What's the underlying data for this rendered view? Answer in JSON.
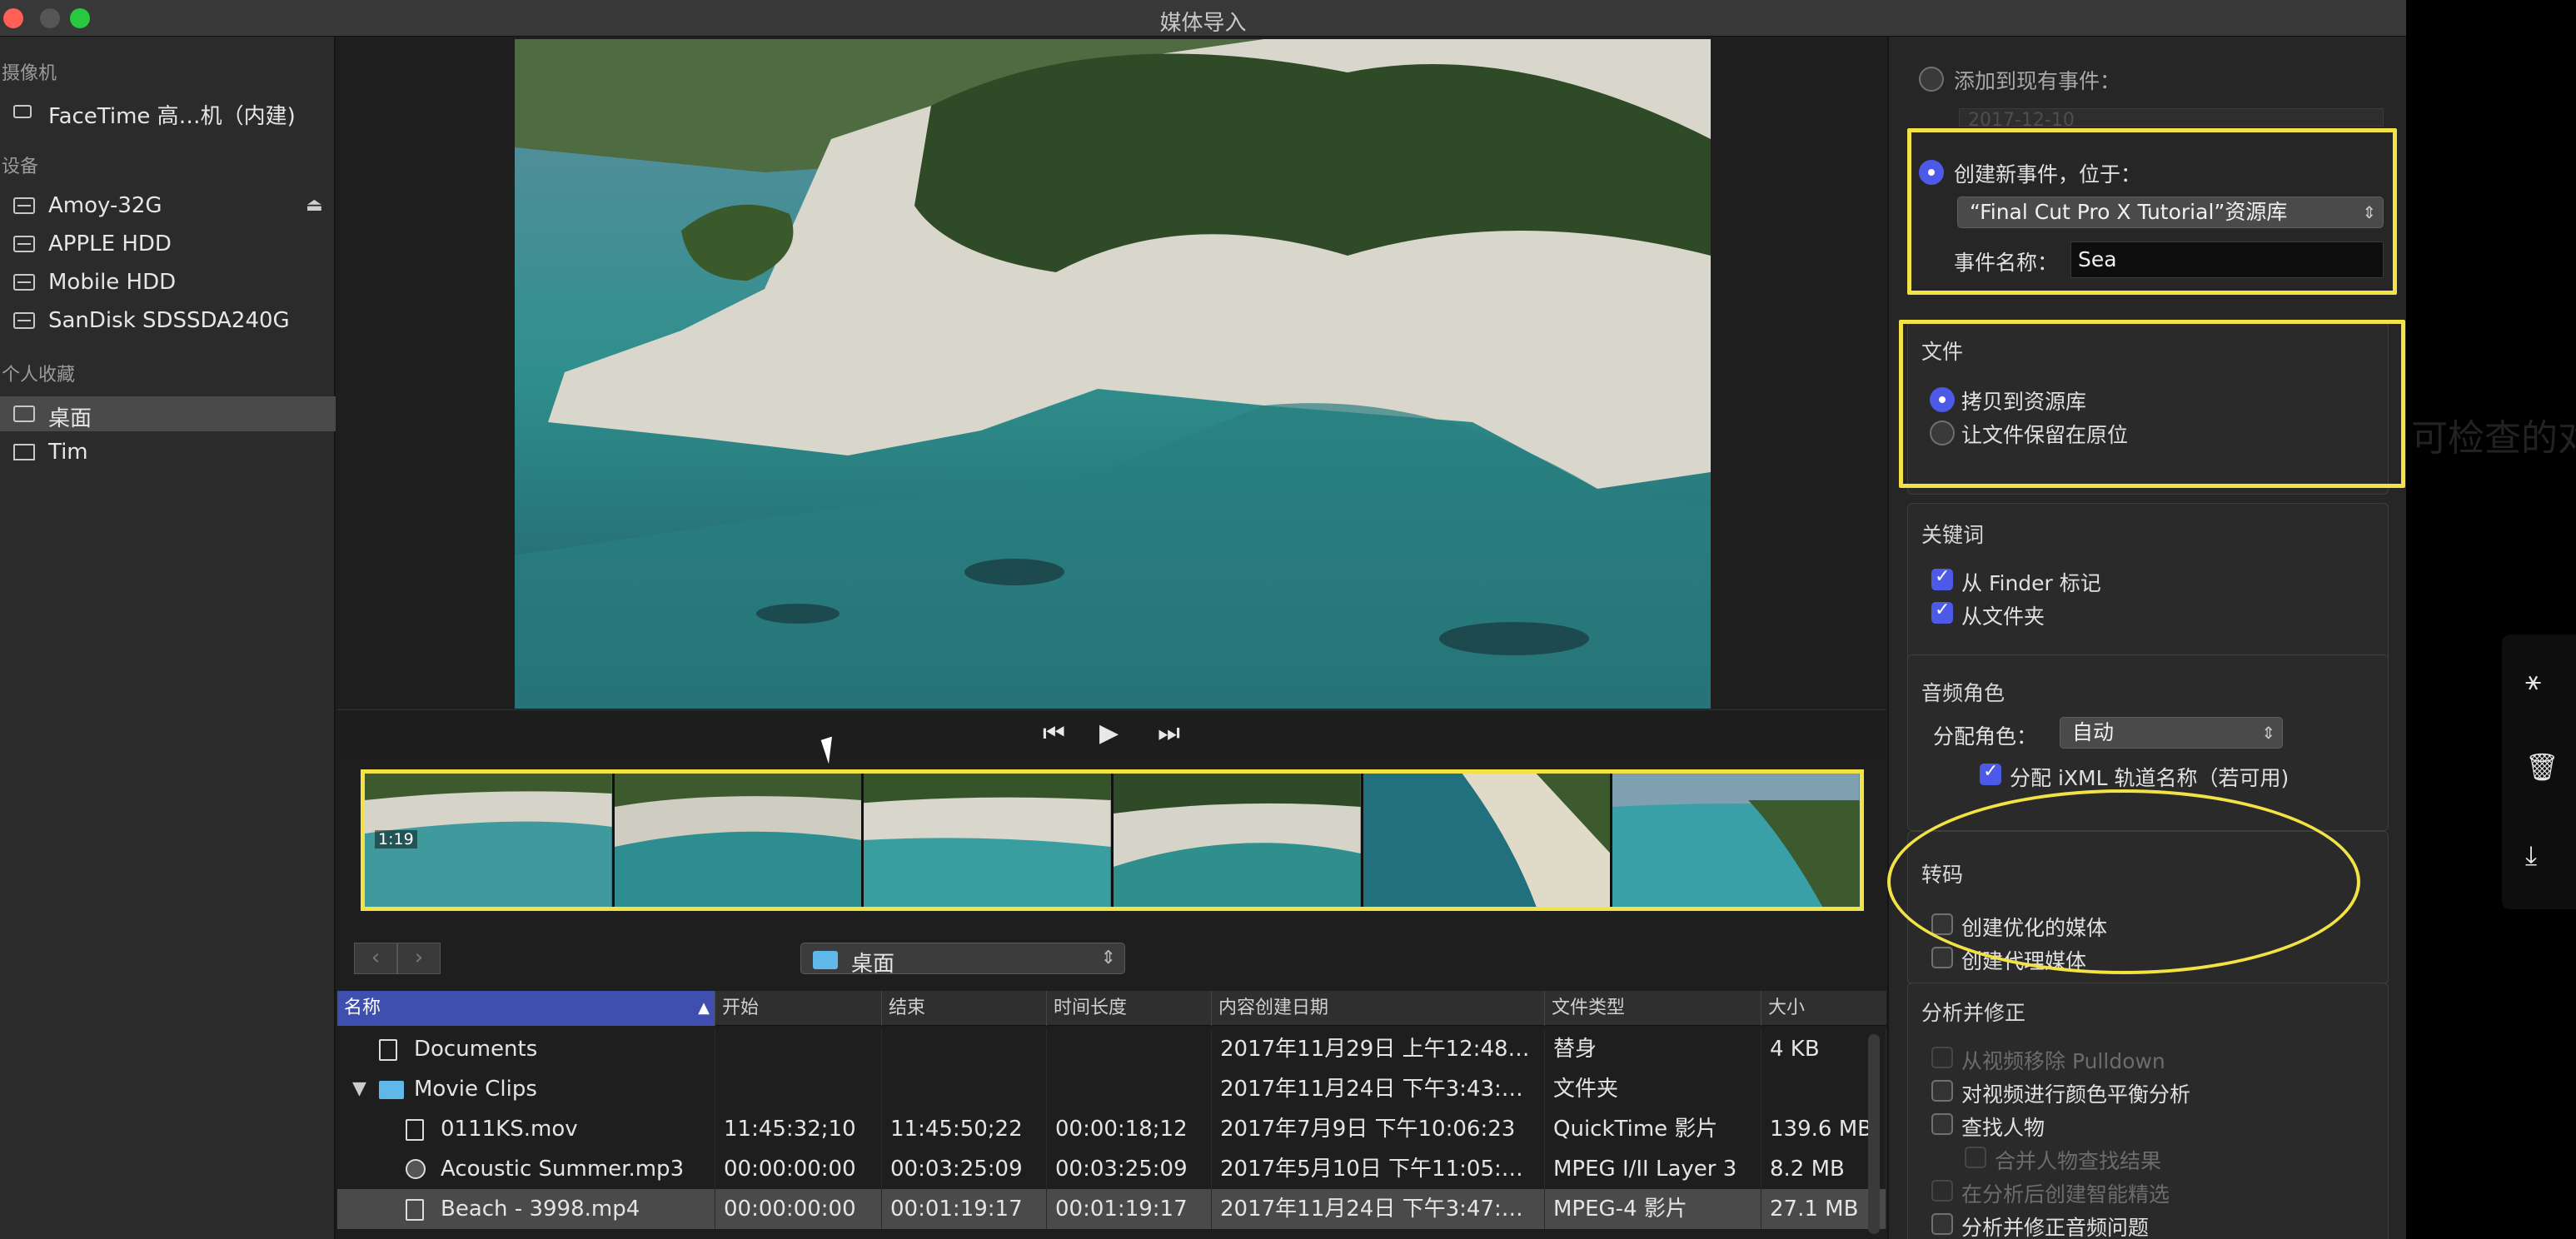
{
  "window": {
    "title": "媒体导入"
  },
  "sidebar": {
    "sections": [
      {
        "header": "摄像机",
        "items": [
          {
            "label": "FaceTime 高…机（内建)",
            "icon": "camera-icon"
          }
        ]
      },
      {
        "header": "设备",
        "items": [
          {
            "label": "Amoy-32G",
            "icon": "disk-icon",
            "eject": "⏏"
          },
          {
            "label": "APPLE HDD",
            "icon": "disk-icon"
          },
          {
            "label": "Mobile HDD",
            "icon": "disk-icon"
          },
          {
            "label": "SanDisk SDSSDA240G",
            "icon": "disk-icon"
          }
        ]
      },
      {
        "header": "个人收藏",
        "items": [
          {
            "label": "桌面",
            "icon": "desktop-icon",
            "selected": true
          },
          {
            "label": "Tim",
            "icon": "home-icon"
          }
        ]
      }
    ]
  },
  "transport": {
    "prev": "⏮",
    "play": "▶",
    "next": "⏭"
  },
  "filmstrip": {
    "duration": "1:19"
  },
  "browser": {
    "back": "‹",
    "forward": "›",
    "location": "桌面",
    "columns": [
      "名称",
      "开始",
      "结束",
      "时间长度",
      "内容创建日期",
      "文件类型",
      "大小"
    ],
    "rows": [
      {
        "name": "Documents",
        "start": "",
        "end": "",
        "duration": "",
        "created": "2017年11月29日 上午12:48…",
        "type": "替身",
        "size": "4 KB",
        "indent": 1,
        "icon": "alias",
        "expander": ""
      },
      {
        "name": "Movie Clips",
        "start": "",
        "end": "",
        "duration": "",
        "created": "2017年11月24日 下午3:43:…",
        "type": "文件夹",
        "size": "",
        "indent": 1,
        "icon": "folder",
        "expander": "▼"
      },
      {
        "name": "0111KS.mov",
        "start": "11:45:32;10",
        "end": "11:45:50;22",
        "duration": "00:00:18;12",
        "created": "2017年7月9日 下午10:06:23",
        "type": "QuickTime 影片",
        "size": "139.6 MB",
        "indent": 2,
        "icon": "doc",
        "expander": ""
      },
      {
        "name": "Acoustic Summer.mp3",
        "start": "00:00:00:00",
        "end": "00:03:25:09",
        "duration": "00:03:25:09",
        "created": "2017年5月10日 下午11:05:…",
        "type": "MPEG I/II Layer 3",
        "size": "8.2 MB",
        "indent": 2,
        "icon": "audio",
        "expander": ""
      },
      {
        "name": "Beach - 3998.mp4",
        "start": "00:00:00:00",
        "end": "00:01:19:17",
        "duration": "00:01:19:17",
        "created": "2017年11月24日 下午3:47:…",
        "type": "MPEG-4 影片",
        "size": "27.1 MB",
        "indent": 2,
        "icon": "doc",
        "expander": "",
        "selected": true
      }
    ]
  },
  "import_options": {
    "add_existing_label": "添加到现有事件：",
    "existing_date": "2017-12-10",
    "create_new_label": "创建新事件，位于：",
    "library": "“Final Cut Pro X Tutorial”资源库",
    "event_name_label": "事件名称：",
    "event_name": "Sea",
    "files": {
      "header": "文件",
      "copy": "拷贝到资源库",
      "leave": "让文件保留在原位"
    },
    "keywords": {
      "header": "关键词",
      "finder": "从 Finder 标记",
      "folders": "从文件夹"
    },
    "audio_roles": {
      "header": "音频角色",
      "assign_label": "分配角色：",
      "assign_value": "自动",
      "ixml": "分配 iXML 轨道名称（若可用)"
    },
    "transcode": {
      "header": "转码",
      "optimized": "创建优化的媒体",
      "proxy": "创建代理媒体"
    },
    "analyze": {
      "header": "分析并修正",
      "pulldown": "从视频移除 Pulldown",
      "color": "对视频进行颜色平衡分析",
      "people": "查找人物",
      "consolidate": "合并人物查找结果",
      "smart": "在分析后创建智能精选",
      "audio": "分析并修正音频问题"
    }
  },
  "background": {
    "ghost_text": "可检查的对"
  },
  "side_strip": {
    "share": "share-icon",
    "delete": "trash-icon",
    "download": "download-icon"
  },
  "colors": {
    "accent": "#4d5ae8",
    "highlight": "#f2e245",
    "folder": "#5fb7ea"
  }
}
